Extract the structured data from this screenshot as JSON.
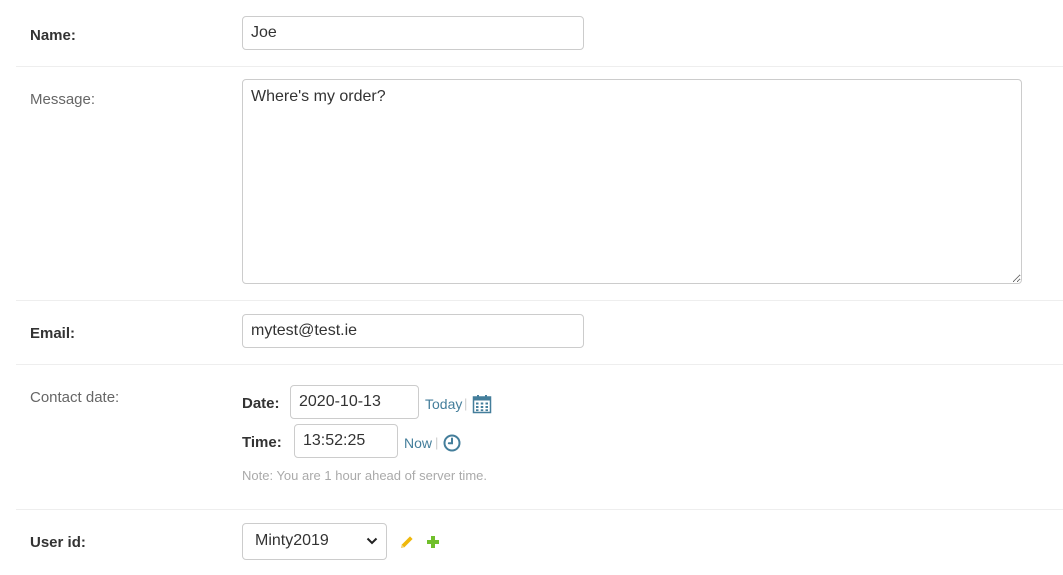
{
  "form": {
    "name": {
      "label": "Name:",
      "value": "Joe"
    },
    "message": {
      "label": "Message:",
      "value": "Where's my order?"
    },
    "email": {
      "label": "Email:",
      "value": "mytest@test.ie"
    },
    "contact_date": {
      "label": "Contact date:",
      "date_label": "Date:",
      "date_value": "2020-10-13",
      "today_link": "Today",
      "time_label": "Time:",
      "time_value": "13:52:25",
      "now_link": "Now",
      "separator": "|",
      "note": "Note: You are 1 hour ahead of server time."
    },
    "user_id": {
      "label": "User id:",
      "selected": "Minty2019"
    }
  },
  "icons": {
    "calendar": "calendar-icon",
    "clock": "clock-icon",
    "edit": "pencil-icon",
    "add": "plus-icon",
    "dropdown": "chevron-down-icon"
  },
  "colors": {
    "link": "#447e9b",
    "pencil": "#efb80b",
    "plus": "#70bf2b",
    "note": "#aaaaaa"
  }
}
